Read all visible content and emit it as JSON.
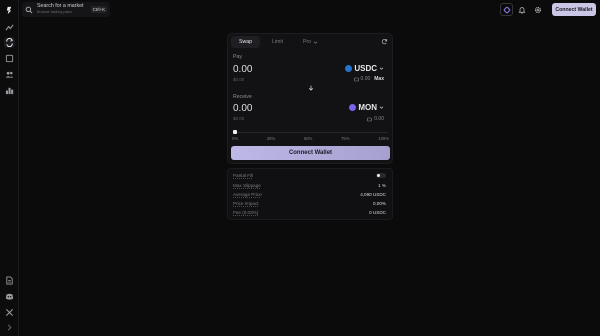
{
  "search": {
    "title": "Search for a market",
    "subtitle": "Browse trading pairs",
    "shortcut": "Ctrl+K"
  },
  "topbar": {
    "connect_label": "Connect Wallet"
  },
  "tabs": [
    {
      "label": "Swap"
    },
    {
      "label": "Limit"
    },
    {
      "label": "Pro"
    }
  ],
  "pay": {
    "label": "Pay",
    "amount": "0.00",
    "usd": "$0.00",
    "token": "USDC",
    "balance": "0.00",
    "max_label": "Max"
  },
  "receive": {
    "label": "Receive",
    "amount": "0.00",
    "usd": "$0.00",
    "token": "MON",
    "balance": "0.00"
  },
  "slider": {
    "ticks": [
      "0%",
      "25%",
      "50%",
      "75%",
      "100%"
    ],
    "value_percent": 0
  },
  "connect_label": "Connect Wallet",
  "details": {
    "partial_fill": {
      "label": "Partial Fill",
      "enabled": false
    },
    "max_slippage": {
      "label": "Max Slippage",
      "value": "1 %"
    },
    "average_price": {
      "label": "Average Price",
      "value": "4,090 USDC"
    },
    "price_impact": {
      "label": "Price Impact",
      "value": "0.00%"
    },
    "fee": {
      "label": "Fee (0.03%)",
      "value": "0 USDC"
    }
  },
  "colors": {
    "accent": "#c9c6e6",
    "usdc": "#2775ca",
    "mon": "#7b63e8",
    "background": "#0b0b0c"
  }
}
